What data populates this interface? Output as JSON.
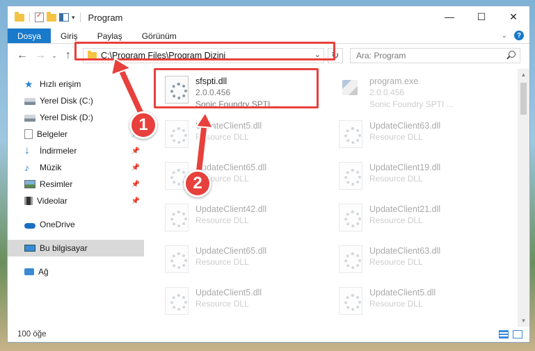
{
  "window": {
    "title": "Program",
    "controls": {
      "minimize": "—",
      "maximize": "☐",
      "close": "✕"
    }
  },
  "ribbon": {
    "file_tab": "Dosya",
    "tabs": [
      "Giriş",
      "Paylaş",
      "Görünüm"
    ],
    "help": "?"
  },
  "nav": {
    "back": "←",
    "forward": "→",
    "up": "↑",
    "address": "C:\\Program Files\\Program Dizini",
    "search_placeholder": "Ara: Program"
  },
  "sidebar": {
    "items": [
      {
        "label": "Hızlı erişim",
        "icon": "star-icon"
      },
      {
        "label": "Yerel Disk (C:)",
        "icon": "drive-icon"
      },
      {
        "label": "Yerel Disk (D:)",
        "icon": "drive-icon"
      },
      {
        "label": "Belgeler",
        "icon": "documents-icon",
        "pinned": true
      },
      {
        "label": "İndirmeler",
        "icon": "downloads-icon",
        "pinned": true
      },
      {
        "label": "Müzik",
        "icon": "music-icon",
        "pinned": true
      },
      {
        "label": "Resimler",
        "icon": "pictures-icon",
        "pinned": true
      },
      {
        "label": "Videolar",
        "icon": "videos-icon",
        "pinned": true
      },
      {
        "label": "OneDrive",
        "icon": "onedrive-icon"
      },
      {
        "label": "Bu bilgisayar",
        "icon": "this-pc-icon",
        "selected": true
      },
      {
        "label": "Ağ",
        "icon": "network-icon"
      }
    ]
  },
  "files": [
    {
      "name": "sfspti.dll",
      "line2": "2.0.0.456",
      "line3": "Sonic Foundry SPTI ..."
    },
    {
      "name": "program.exe",
      "line2": "2.0.0.456",
      "line3": "Sonic Foundry SPTI ..."
    },
    {
      "name": "UpdateClient5.dll",
      "line2": "Resource DLL"
    },
    {
      "name": "UpdateClient63.dll",
      "line2": "Resource DLL"
    },
    {
      "name": "UpdateClient65.dll",
      "line2": "Resource DLL"
    },
    {
      "name": "UpdateClient19.dll",
      "line2": "Resource DLL"
    },
    {
      "name": "UpdateClient42.dll",
      "line2": "Resource DLL"
    },
    {
      "name": "UpdateClient21.dll",
      "line2": "Resource DLL"
    },
    {
      "name": "UpdateClient65.dll",
      "line2": "Resource DLL"
    },
    {
      "name": "UpdateClient63.dll",
      "line2": "Resource DLL"
    },
    {
      "name": "UpdateClient5.dll",
      "line2": "Resource DLL"
    },
    {
      "name": "UpdateClient5.dll",
      "line2": "Resource DLL"
    }
  ],
  "status": {
    "count": "100 öğe"
  },
  "callouts": {
    "one": "1",
    "two": "2"
  },
  "colors": {
    "accent": "#1979ca",
    "highlight": "#e8403c"
  }
}
